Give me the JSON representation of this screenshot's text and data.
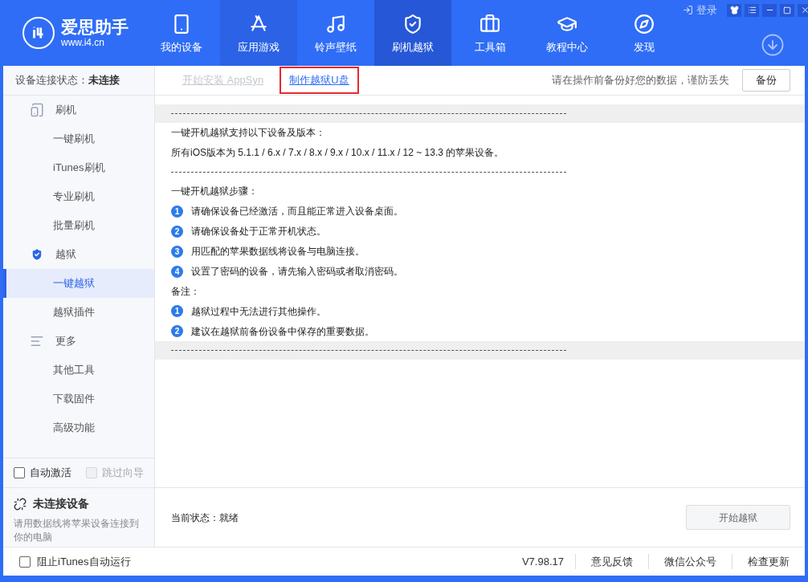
{
  "app": {
    "logo_name": "爱思助手",
    "logo_url": "www.i4.cn"
  },
  "title_bar": {
    "login": "登录"
  },
  "nav": [
    {
      "label": "我的设备",
      "selected": false,
      "highlighted": false
    },
    {
      "label": "应用游戏",
      "selected": false,
      "highlighted": true
    },
    {
      "label": "铃声壁纸",
      "selected": false,
      "highlighted": false
    },
    {
      "label": "刷机越狱",
      "selected": true,
      "highlighted": false
    },
    {
      "label": "工具箱",
      "selected": false,
      "highlighted": false
    },
    {
      "label": "教程中心",
      "selected": false,
      "highlighted": false
    },
    {
      "label": "发现",
      "selected": false,
      "highlighted": false
    }
  ],
  "sub_bar": {
    "status_label": "设备连接状态：",
    "status_value": "未连接",
    "links": [
      {
        "label": "开始安装 AppSyn",
        "disabled": true,
        "outlined": false
      },
      {
        "label": "制作越狱U盘",
        "disabled": false,
        "outlined": true
      }
    ],
    "hint": "请在操作前备份好您的数据，谨防丢失",
    "backup_button": "备份"
  },
  "sidebar": {
    "sections": [
      {
        "label": "刷机",
        "children": [
          {
            "label": "一键刷机",
            "selected": false
          },
          {
            "label": "iTunes刷机",
            "selected": false
          },
          {
            "label": "专业刷机",
            "selected": false
          },
          {
            "label": "批量刷机",
            "selected": false
          }
        ]
      },
      {
        "label": "越狱",
        "children": [
          {
            "label": "一键越狱",
            "selected": true
          },
          {
            "label": "越狱插件",
            "selected": false
          }
        ]
      },
      {
        "label": "更多",
        "children": [
          {
            "label": "其他工具",
            "selected": false
          },
          {
            "label": "下载固件",
            "selected": false
          },
          {
            "label": "高级功能",
            "selected": false
          }
        ]
      }
    ],
    "checkboxes": [
      {
        "label": "自动激活",
        "checked": false,
        "disabled": false
      },
      {
        "label": "跳过向导",
        "checked": false,
        "disabled": true
      }
    ],
    "device": {
      "title": "未连接设备",
      "description": "请用数据线将苹果设备连接到你的电脑"
    }
  },
  "content": [
    {
      "kind": "band_rule"
    },
    {
      "kind": "text",
      "text": "一键开机越狱支持以下设备及版本："
    },
    {
      "kind": "text",
      "text": "所有iOS版本为 5.1.1 / 6.x / 7.x / 8.x / 9.x / 10.x / 11.x / 12 ~ 13.3 的苹果设备。"
    },
    {
      "kind": "rule"
    },
    {
      "kind": "text",
      "text": "一键开机越狱步骤："
    },
    {
      "kind": "step",
      "number": "1",
      "text": "请确保设备已经激活，而且能正常进入设备桌面。"
    },
    {
      "kind": "step",
      "number": "2",
      "text": "请确保设备处于正常开机状态。"
    },
    {
      "kind": "step",
      "number": "3",
      "text": "用匹配的苹果数据线将设备与电脑连接。"
    },
    {
      "kind": "step",
      "number": "4",
      "text": "设置了密码的设备，请先输入密码或者取消密码。"
    },
    {
      "kind": "text",
      "text": "备注："
    },
    {
      "kind": "step",
      "number": "1",
      "text": "越狱过程中无法进行其他操作。"
    },
    {
      "kind": "step",
      "number": "2",
      "text": "建议在越狱前备份设备中保存的重要数据。"
    },
    {
      "kind": "band_rule"
    }
  ],
  "status": {
    "label": "当前状态：",
    "value": "就绪",
    "start_button": "开始越狱",
    "start_disabled": true
  },
  "footer": {
    "itunes_checkbox": {
      "label": "阻止iTunes自动运行",
      "checked": false
    },
    "version": "V7.98.17",
    "links": [
      "意见反馈",
      "微信公众号",
      "检查更新"
    ]
  }
}
